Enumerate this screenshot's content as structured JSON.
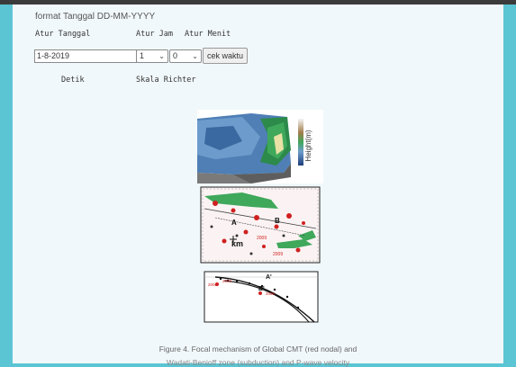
{
  "header": {
    "format_text": "format Tanggal DD-MM-YYYY"
  },
  "form": {
    "date_label": "Atur Tanggal",
    "hour_label": "Atur Jam",
    "minute_label": "Atur Menit",
    "date_value": "1-8-2019",
    "hour_value": "1",
    "minute_value": "0",
    "check_button_label": "cek waktu",
    "seconds_label": "Detik",
    "richter_label": "Skala Richter"
  },
  "figure": {
    "colorbar_label": "Height(m)",
    "map_labels": {
      "a": "A",
      "b": "B",
      "km": "km"
    },
    "section_labels": {
      "a": "A'",
      "b": "B'"
    },
    "years": [
      "2009",
      "2006",
      "2006",
      "2006",
      "2009"
    ]
  },
  "caption": {
    "line1": "Figure 4. Focal mechanism of Global CMT (red nodal) and",
    "line2": "Wadati-Benioff zone (subduction) and P-wave velocity"
  },
  "colors": {
    "background": "#5bc5d3",
    "panel": "#f1f8fb",
    "topbar": "#3b3b3b"
  }
}
